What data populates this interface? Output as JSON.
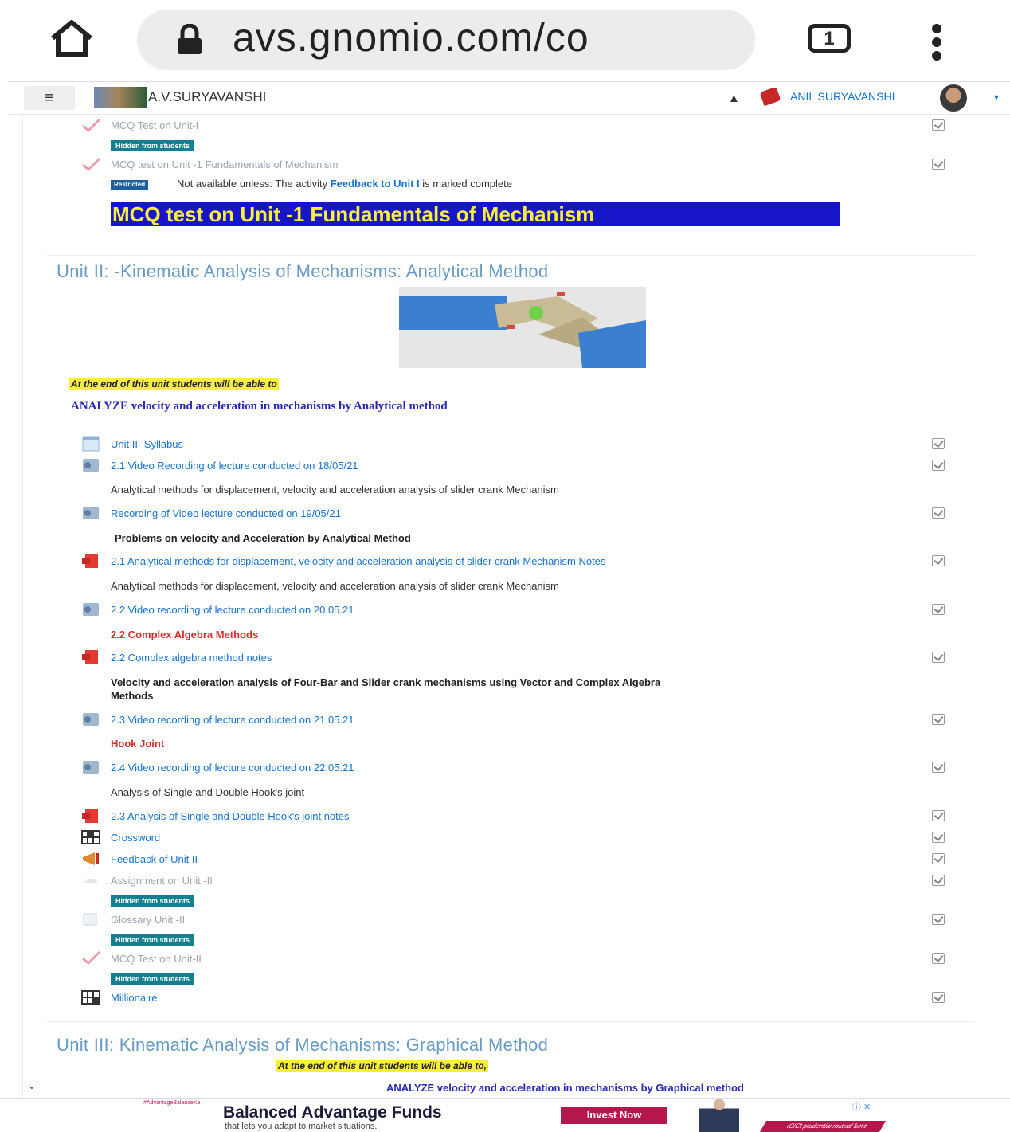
{
  "browser": {
    "url": "avs.gnomio.com/co",
    "tab_count": "1"
  },
  "navbar": {
    "menu_icon": "hamburger-icon",
    "site_name": "A.V.SURYAVANSHI",
    "user_name": "ANIL SURYAVANSHI",
    "caret": "▾"
  },
  "unit1_tail": {
    "items": [
      {
        "label": "MCQ Test on Unit-I",
        "badge": "Hidden from students"
      },
      {
        "label": "MCQ test on Unit -1 Fundamentals of Mechanism"
      }
    ],
    "restricted_badge": "Restricted",
    "restriction_prefix": "Not available unless: The activity ",
    "restriction_link": "Feedback to Unit I",
    "restriction_suffix": " is marked complete",
    "banner": "MCQ test on Unit -1 Fundamentals of Mechanism"
  },
  "unit2": {
    "title": "Unit II: -Kinematic Analysis of Mechanisms: Analytical Method",
    "objective_intro": "At the end of this unit students will be able to",
    "objective": "ANALYZE velocity and acceleration in mechanisms by Analytical method",
    "links": {
      "syllabus": "Unit II- Syllabus",
      "video1": "2.1 Video Recording of lecture conducted on 18/05/21",
      "video2": "Recording of Video lecture conducted on 19/05/21",
      "notes1": "2.1 Analytical methods for displacement, velocity and acceleration analysis of slider crank Mechanism Notes",
      "video3": "2.2 Video recording of lecture conducted on 20.05.21",
      "notes2": "2.2 Complex algebra method notes",
      "video4": "2.3 Video recording of lecture conducted on 21.05.21",
      "video5": "2.4 Video recording of lecture conducted on 22.05.21",
      "notes3": "2.3 Analysis of Single and Double Hook's joint notes",
      "crossword": "Crossword",
      "feedback": "Feedback of Unit II",
      "assignment": "Assignment on Unit -II",
      "glossary": "Glossary Unit -II",
      "mcq": "MCQ Test on Unit-II",
      "millionaire": "Millionaire"
    },
    "texts": {
      "desc1": "Analytical methods for displacement, velocity and acceleration analysis of slider crank Mechanism",
      "problems": "Problems on velocity and Acceleration by Analytical Method",
      "desc2": "Analytical methods for displacement, velocity and acceleration analysis of slider crank Mechanism",
      "complex_heading": "2.2 Complex Algebra Methods",
      "vector_line1": "Velocity and acceleration analysis of Four-Bar and Slider crank mechanisms using Vector and Complex Algebra",
      "vector_line2": "Methods",
      "hook_heading": "Hook Joint",
      "hook_desc": "Analysis of Single and Double Hook's joint"
    },
    "hidden_badge": "Hidden from students"
  },
  "unit3": {
    "title": "Unit III: Kinematic Analysis of Mechanisms: Graphical Method",
    "objective_intro": "At the end of this unit students will be able to,",
    "objective": "ANALYZE velocity and acceleration in mechanisms by Graphical method"
  },
  "ad": {
    "tag": "#AdvantageBalanceKa",
    "title": "Balanced Advantage Funds",
    "subtitle": "that lets you adapt to market situations.",
    "button": "Invest Now",
    "close": "ⓘ ✕",
    "ribbon": "ICICI prudential mutual fund"
  },
  "colors": {
    "link": "#1a73c9",
    "section_title": "#6a9bc3",
    "badge_hidden": "#137f8f",
    "banner_bg": "#1616c8",
    "banner_text": "#ffef3a",
    "highlight": "#f7f036",
    "red_heading": "#d32f2f"
  }
}
